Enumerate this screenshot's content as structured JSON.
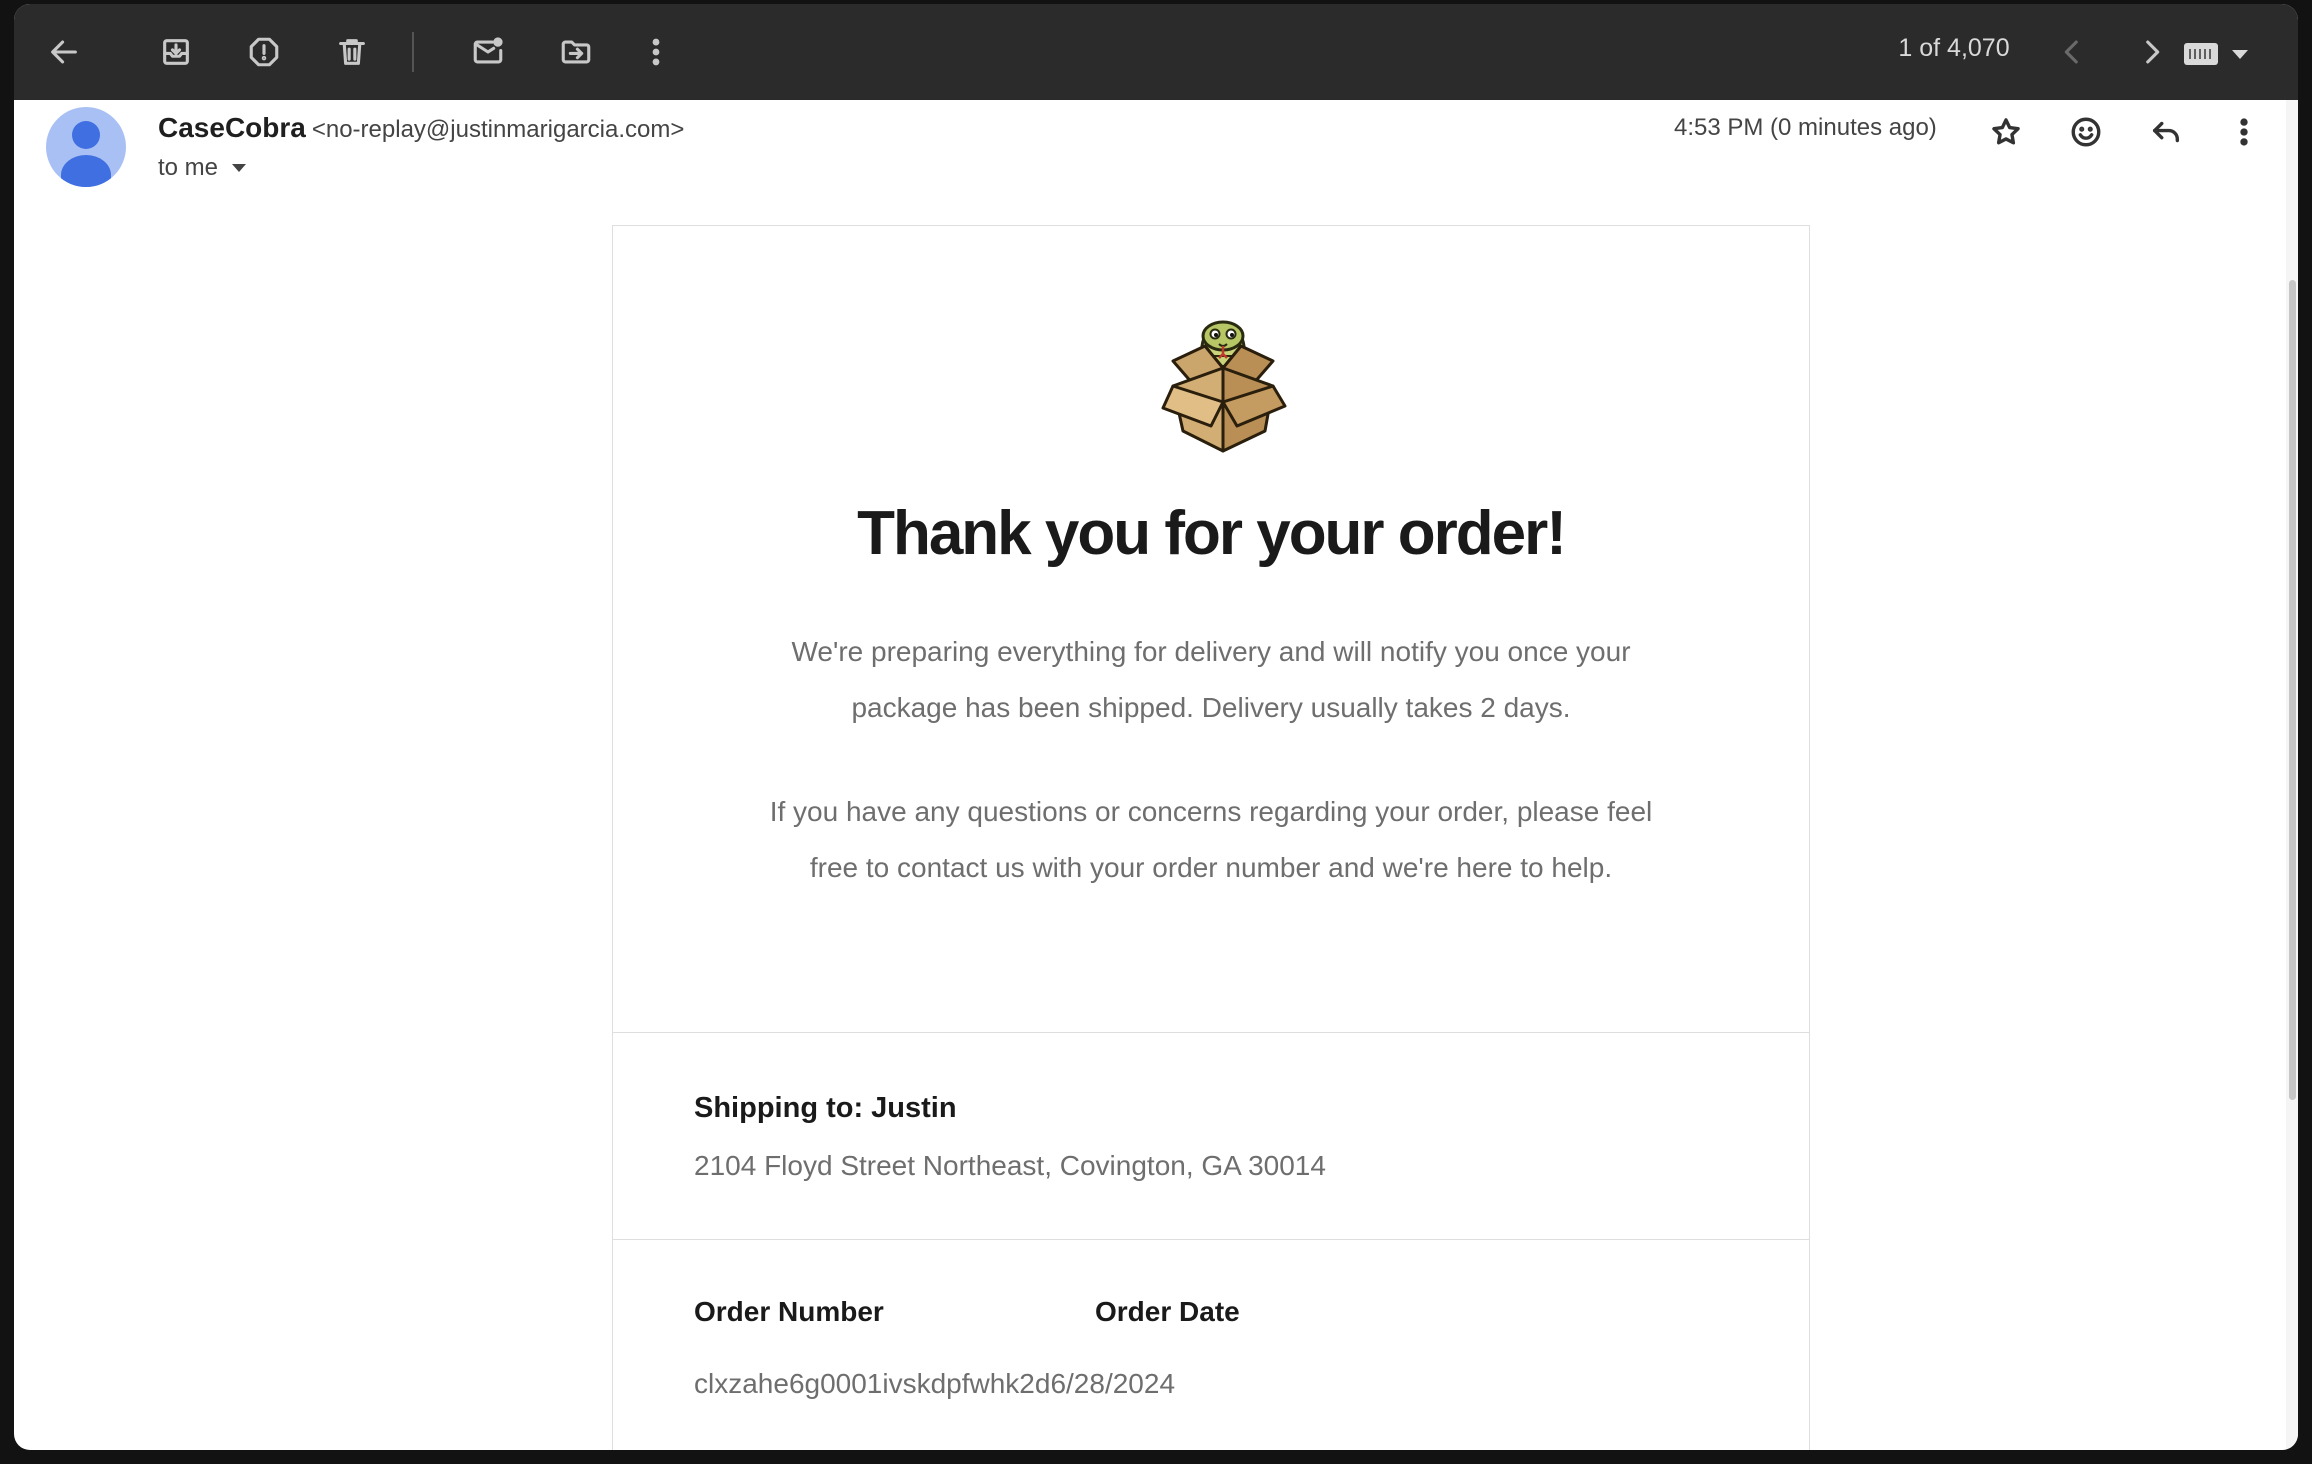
{
  "toolbar": {
    "pager": "1 of 4,070"
  },
  "email": {
    "sender_name": "CaseCobra",
    "sender_email": "<no-replay@justinmarigarcia.com>",
    "recipient": "to me",
    "timestamp": "4:53 PM (0 minutes ago)"
  },
  "body": {
    "heading": "Thank you for your order!",
    "paragraph_1": "We're preparing everything for delivery and will notify you once your package has been shipped. Delivery usually takes 2 days.",
    "paragraph_2": "If you have any questions or concerns regarding your order, please feel free to contact us with your order number and we're here to help.",
    "shipping_title": "Shipping to: Justin",
    "shipping_address": "2104 Floyd Street Northeast, Covington, GA 30014",
    "order_number_label": "Order Number",
    "order_date_label": "Order Date",
    "order_number_value": "clxzahe6g0001ivskdpfwhk2d",
    "order_date_value": "6/28/2024"
  },
  "icons": {
    "toolbar": [
      "back-arrow-icon",
      "archive-icon",
      "report-spam-icon",
      "delete-icon",
      "mark-unread-icon",
      "move-to-icon",
      "more-vert-icon",
      "prev-chevron-icon",
      "next-chevron-icon",
      "keyboard-icon"
    ],
    "header": [
      "star-icon",
      "emoji-react-icon",
      "reply-icon",
      "more-vert-icon"
    ]
  },
  "colors": {
    "toolbar_bg": "#2b2b2b",
    "avatar_bg": "#a8c0f4",
    "avatar_fg": "#3f6fe0"
  }
}
